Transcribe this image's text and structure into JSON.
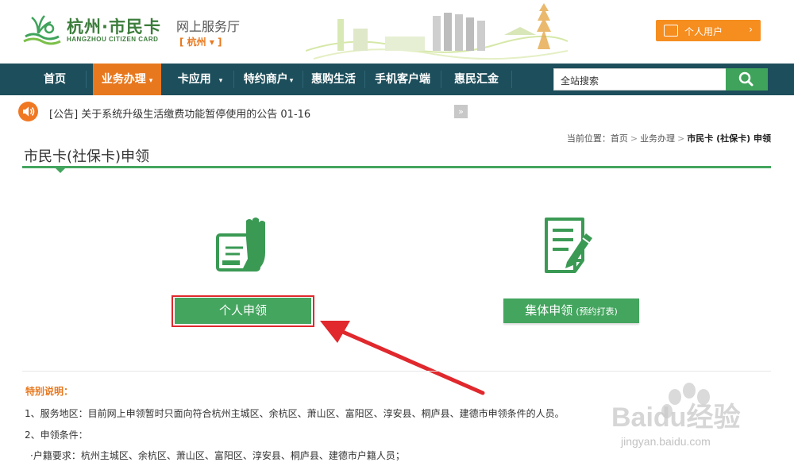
{
  "header": {
    "logo_title": "杭州·市民卡",
    "logo_subtitle": "HANGZHOU CITIZEN CARD",
    "hall_title": "网上服务厅",
    "city": "[ 杭州 ▾ ]",
    "user_button": "个人用户",
    "user_button_arrow": "›"
  },
  "nav": {
    "items": [
      {
        "label": "首页"
      },
      {
        "label": "业务办理"
      },
      {
        "label": "卡应用"
      },
      {
        "label": "特约商户"
      },
      {
        "label": "惠购生活"
      },
      {
        "label": "手机客户端"
      },
      {
        "label": "惠民汇金"
      }
    ],
    "caret": "▾",
    "search_value": "全站搜索"
  },
  "notice": {
    "text": "[公告] 关于系统升级生活缴费功能暂停使用的公告 01-16",
    "next": "»"
  },
  "breadcrumb": {
    "prefix": "当前位置：",
    "items": [
      "首页",
      "业务办理",
      "市民卡 (社保卡) 申领"
    ],
    "separator": ">"
  },
  "section": {
    "title": "市民卡(社保卡)申领"
  },
  "options": {
    "personal_label": "个人申领",
    "group_label": "集体申领",
    "group_sub": "(预约打表)"
  },
  "notes": {
    "title": "特别说明：",
    "lines": [
      "1、服务地区：目前网上申领暂时只面向符合杭州主城区、余杭区、萧山区、富阳区、淳安县、桐庐县、建德市申领条件的人员。",
      "2、申领条件：",
      "·户籍要求：杭州主城区、余杭区、萧山区、富阳区、淳安县、桐庐县、建德市户籍人员；"
    ]
  },
  "watermark": {
    "brand": "Baidu经验",
    "url": "jingyan.baidu.com"
  },
  "colors": {
    "nav_bg": "#1d4e5b",
    "active_orange": "#e8781e",
    "green": "#44a55f",
    "highlight_red": "#e0282d"
  }
}
